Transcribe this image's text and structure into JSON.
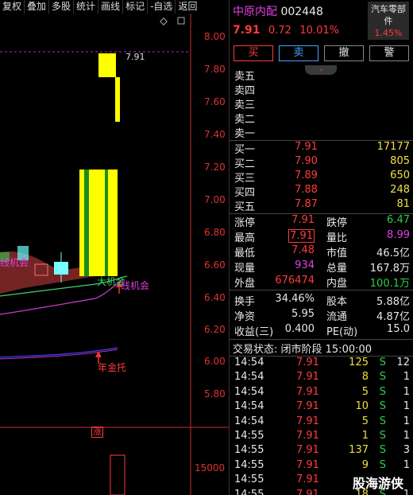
{
  "toolbar": {
    "items": [
      "复权",
      "叠加",
      "多股",
      "统计",
      "画线",
      "标记",
      "-自选",
      "返回"
    ]
  },
  "stock": {
    "name": "中原内配",
    "code": "002448",
    "price": "7.91",
    "change": "0.72",
    "pct": "10.01%",
    "sector": "汽车零部件",
    "sector_pct": "1.45%"
  },
  "actions": {
    "buy": "买",
    "sell": "卖",
    "cancel": "撤",
    "alert": "警"
  },
  "sell_orders": [
    "卖五",
    "卖四",
    "卖三",
    "卖二",
    "卖一"
  ],
  "buy_orders": [
    {
      "label": "买一",
      "price": "7.91",
      "vol": "17177"
    },
    {
      "label": "买二",
      "price": "7.90",
      "vol": "805"
    },
    {
      "label": "买三",
      "price": "7.89",
      "vol": "650"
    },
    {
      "label": "买四",
      "price": "7.88",
      "vol": "248"
    },
    {
      "label": "买五",
      "price": "7.87",
      "vol": "81"
    }
  ],
  "stats": [
    {
      "l1": "涨停",
      "v1": "7.91",
      "l2": "跌停",
      "v2": "6.47"
    },
    {
      "l1": "最高",
      "v1": "7.91",
      "l2": "量比",
      "v2": "8.99"
    },
    {
      "l1": "最低",
      "v1": "7.48",
      "l2": "市值",
      "v2": "46.5亿"
    },
    {
      "l1": "现量",
      "v1": "934",
      "l2": "总量",
      "v2": "167.8万"
    },
    {
      "l1": "外盘",
      "v1": "676474",
      "l2": "内盘",
      "v2": "100.1万"
    },
    {
      "l1": "换手",
      "v1": "34.46%",
      "l2": "股本",
      "v2": "5.88亿"
    },
    {
      "l1": "净资",
      "v1": "5.95",
      "l2": "流通",
      "v2": "4.87亿"
    },
    {
      "l1": "收益(三)",
      "v1": "0.400",
      "l2": "PE(动)",
      "v2": "15.0"
    }
  ],
  "trade_status": "交易状态: 闭市阶段 15:00:00",
  "ticks": [
    {
      "t": "14:54",
      "p": "7.91",
      "v": "125",
      "s": "S",
      "n": "12"
    },
    {
      "t": "14:54",
      "p": "7.91",
      "v": "8",
      "s": "S",
      "n": "1"
    },
    {
      "t": "14:54",
      "p": "7.91",
      "v": "5",
      "s": "S",
      "n": "1"
    },
    {
      "t": "14:54",
      "p": "7.91",
      "v": "10",
      "s": "S",
      "n": "1"
    },
    {
      "t": "14:54",
      "p": "7.91",
      "v": "5",
      "s": "S",
      "n": "1"
    },
    {
      "t": "14:55",
      "p": "7.91",
      "v": "1",
      "s": "S",
      "n": "1"
    },
    {
      "t": "14:55",
      "p": "7.91",
      "v": "137",
      "s": "S",
      "n": "3"
    },
    {
      "t": "14:55",
      "p": "7.91",
      "v": "9",
      "s": "S",
      "n": "1"
    },
    {
      "t": "14:55",
      "p": "7.91",
      "v": "",
      "s": "",
      "n": ""
    },
    {
      "t": "14:55",
      "p": "7.91",
      "v": "18",
      "s": "S",
      "n": "1"
    }
  ],
  "chart": {
    "price_labels": [
      "8.00",
      "7.80",
      "7.60",
      "7.40",
      "7.20",
      "7.00",
      "6.80",
      "6.60",
      "6.40",
      "6.20",
      "6.00",
      "5.80"
    ],
    "vol_label": "15000",
    "high_marker": "7.91",
    "annotations": {
      "big_chance": "大机会",
      "line_chance": "线机会",
      "year_support": "年金托",
      "left_chance": "线机会",
      "zhang": "涨"
    }
  },
  "watermark": "股海游侠",
  "colors": {
    "up": "#ff3b3b",
    "down": "#27d14b",
    "accent": "#f0e040"
  }
}
